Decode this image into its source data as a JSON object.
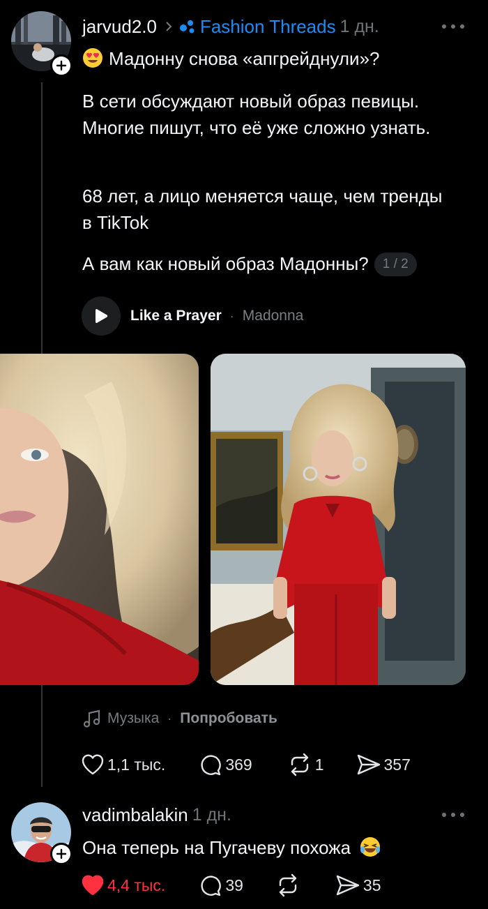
{
  "post": {
    "username": "jarvud2.0",
    "community": "Fashion Threads",
    "time": "1 дн.",
    "title": "Мадонну снова «апгрейднули»?",
    "paragraph_1": "В сети обсуждают новый образ певицы. Многие пишут, что её уже сложно узнать.",
    "paragraph_2": "68 лет, а лицо меняется чаще, чем тренды в TikTok",
    "question": "А вам как новый образ Мадонны?",
    "page_counter": "1 / 2",
    "song": "Like a Prayer",
    "artist": "Madonna",
    "music_label": "Музыка",
    "try_label": "Попробовать",
    "likes": "1,1 тыс.",
    "comments": "369",
    "reposts": "1",
    "shares": "357"
  },
  "reply": {
    "username": "vadimbalakin",
    "time": "1 дн.",
    "text": "Она теперь на Пугачеву похожа",
    "likes": "4,4 тыс.",
    "comments": "39",
    "shares": "35"
  },
  "colors": {
    "background": "#000000",
    "text": "#f3f5f7",
    "muted": "#6f7478",
    "link_blue": "#1b8cf5",
    "like_red": "#ff3040"
  },
  "icons": [
    "plus-icon",
    "chevron-right-icon",
    "community-dots-icon",
    "more-icon",
    "heart-eyes-emoji",
    "play-icon",
    "music-note-icon",
    "heart-icon",
    "comment-icon",
    "repost-icon",
    "share-icon",
    "laughing-emoji"
  ]
}
